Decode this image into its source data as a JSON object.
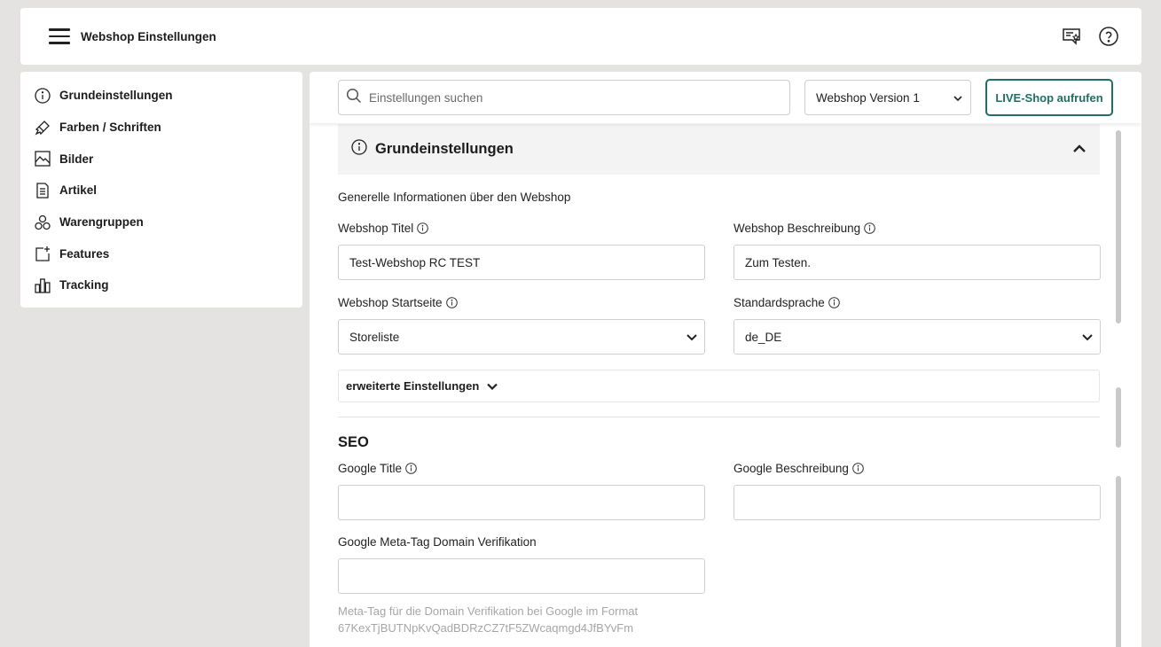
{
  "header": {
    "title": "Webshop Einstellungen",
    "icons": [
      "menu-icon",
      "feedback-icon",
      "help-icon"
    ]
  },
  "sidebar": {
    "items": [
      {
        "label": "Grundeinstellungen",
        "icon": "info-icon"
      },
      {
        "label": "Farben / Schriften",
        "icon": "brush-icon"
      },
      {
        "label": "Bilder",
        "icon": "image-icon"
      },
      {
        "label": "Artikel",
        "icon": "document-icon"
      },
      {
        "label": "Warengruppen",
        "icon": "groups-icon"
      },
      {
        "label": "Features",
        "icon": "add-feature-icon"
      },
      {
        "label": "Tracking",
        "icon": "bar-chart-icon"
      }
    ]
  },
  "toolbar": {
    "search_placeholder": "Einstellungen suchen",
    "version_selected": "Webshop Version 1",
    "live_button": "LIVE-Shop aufrufen",
    "accent_color": "#1f6f63"
  },
  "section": {
    "title": "Grundeinstellungen",
    "description": "Generelle Informationen über den Webshop",
    "fields": {
      "shop_title": {
        "label": "Webshop Titel",
        "value": "Test-Webshop RC TEST"
      },
      "shop_description": {
        "label": "Webshop Beschreibung",
        "value": "Zum Testen."
      },
      "start_page": {
        "label": "Webshop Startseite",
        "value": "Storeliste"
      },
      "language": {
        "label": "Standardsprache",
        "value": "de_DE"
      }
    },
    "advanced_label": "erweiterte Einstellungen"
  },
  "seo": {
    "heading": "SEO",
    "google_title": {
      "label": "Google Title",
      "value": ""
    },
    "google_description": {
      "label": "Google Beschreibung",
      "value": ""
    },
    "meta_tag": {
      "label": "Google Meta-Tag Domain Verifikation",
      "value": ""
    },
    "meta_hint": "Meta-Tag für die Domain Verifikation bei Google im Format 67KexTjBUTNpKvQadBDRzCZ7tF5ZWcaqmgd4JfBYvFm"
  }
}
